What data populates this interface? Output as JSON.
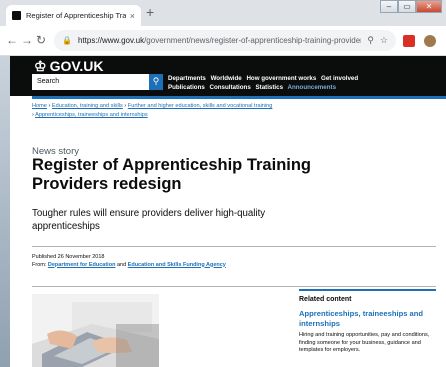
{
  "browser": {
    "tab_title": "Register of Apprenticeship Trainin",
    "tab_close": "×",
    "new_tab": "+",
    "window_buttons": [
      "–",
      "▭",
      "✕"
    ],
    "url_host": "https://www.gov.uk",
    "url_path": "/government/news/register-of-apprenticeship-training-providers-..."
  },
  "site": {
    "logo": "GOV.UK",
    "search_placeholder": "Search",
    "nav_row1": [
      "Departments",
      "Worldwide",
      "How government works",
      "Get involved"
    ],
    "nav_row2": [
      "Publications",
      "Consultations",
      "Statistics",
      "Announcements"
    ]
  },
  "breadcrumb": {
    "items": [
      "Home",
      "Education, training and skills",
      "Further and higher education, skills and vocational training",
      "Apprenticeships, traineeships and internships"
    ]
  },
  "article": {
    "label": "News story",
    "title": "Register of Apprenticeship Training Providers redesign",
    "lead": "Tougher rules will ensure providers deliver high-quality apprenticeships",
    "published": "Published 26 November 2018",
    "from_prefix": "From: ",
    "from_org1": "Department for Education",
    "from_and": " and ",
    "from_org2": "Education and Skills Funding Agency"
  },
  "related": {
    "heading": "Related content",
    "link": "Apprenticeships, traineeships and internships",
    "description": "Hiring and training opportunities, pay and conditions, finding someone for your business, guidance and templates for employers."
  },
  "colors": {
    "brand_black": "#0b0c0c",
    "link_blue": "#1d70b8"
  }
}
